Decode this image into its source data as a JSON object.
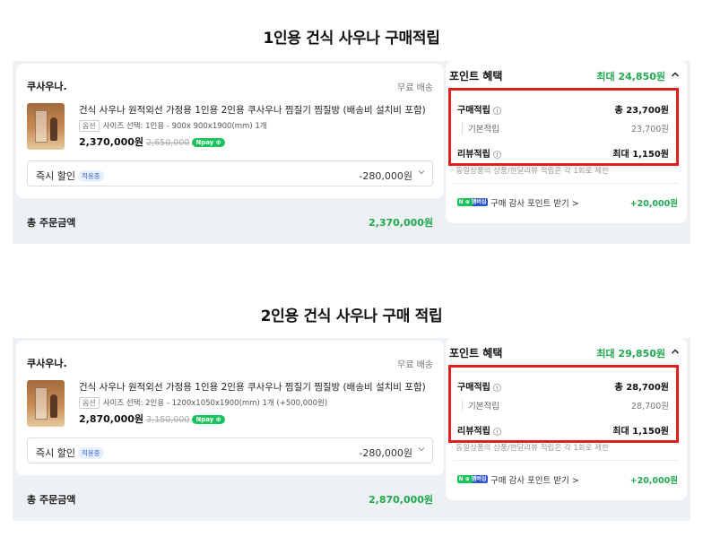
{
  "colors": {
    "accent_green": "#20a84f",
    "highlight_red": "#e0201b",
    "section_bg": "#eef1f4"
  },
  "sections": [
    {
      "heading": "1인용 건식 사우나 구매적립",
      "order": {
        "shop_name": "쿠사우나.",
        "shipping": "무료 배송",
        "product_image": "sauna-product-photo",
        "product_title": "건식 사우나 원적외선 가정용 1인용 2인용 쿠사우나 찜질기 찜질방 (배송비 설치비 포함)",
        "option_tag": "옵션",
        "option_text": "사이즈 선택: 1인용 - 900x 900x1900(mm)",
        "quantity": "1개",
        "price": "2,370,000원",
        "original_price": "2,650,000",
        "pay_badge": "Npay ⊕",
        "discount_label": "즉시 할인",
        "discount_tag": "적용중",
        "discount_amount": "-280,000원",
        "total_label": "총 주문금액",
        "total_amount": "2,370,000원"
      },
      "points": {
        "title": "포인트 혜택",
        "max": "최대 24,850원",
        "purchase_label": "구매적립",
        "purchase_value": "총 23,700원",
        "base_label": "기본적립",
        "base_value": "23,700원",
        "review_label": "리뷰적립",
        "review_value": "최대 1,150원",
        "note": "· 동일상품의 상품/한달리뷰 적립은 각 1회로 제한",
        "npay_badge": "N ⊕ 멤버십",
        "review_cta": "구매 감사 포인트 받기 >",
        "review_points": "+20,000원"
      }
    },
    {
      "heading": "2인용 건식 사우나 구매 적립",
      "order": {
        "shop_name": "쿠사우나.",
        "shipping": "무료 배송",
        "product_image": "sauna-product-photo",
        "product_title": "건식 사우나 원적외선 가정용 1인용 2인용 쿠사우나 찜질기 찜질방 (배송비 설치비 포함)",
        "option_tag": "옵션",
        "option_text": "사이즈 선택: 2인용 - 1200x1050x1900(mm)",
        "quantity": "1개 (+500,000원)",
        "price": "2,870,000원",
        "original_price": "3,150,000",
        "pay_badge": "Npay ⊕",
        "discount_label": "즉시 할인",
        "discount_tag": "적용중",
        "discount_amount": "-280,000원",
        "total_label": "총 주문금액",
        "total_amount": "2,870,000원"
      },
      "points": {
        "title": "포인트 혜택",
        "max": "최대 29,850원",
        "purchase_label": "구매적립",
        "purchase_value": "총 28,700원",
        "base_label": "기본적립",
        "base_value": "28,700원",
        "review_label": "리뷰적립",
        "review_value": "최대 1,150원",
        "note": "· 동일상품의 상품/한달리뷰 적립은 각 1회로 제한",
        "npay_badge": "N ⊕ 멤버십",
        "review_cta": "구매 감사 포인트 받기 >",
        "review_points": "+20,000원"
      }
    }
  ]
}
